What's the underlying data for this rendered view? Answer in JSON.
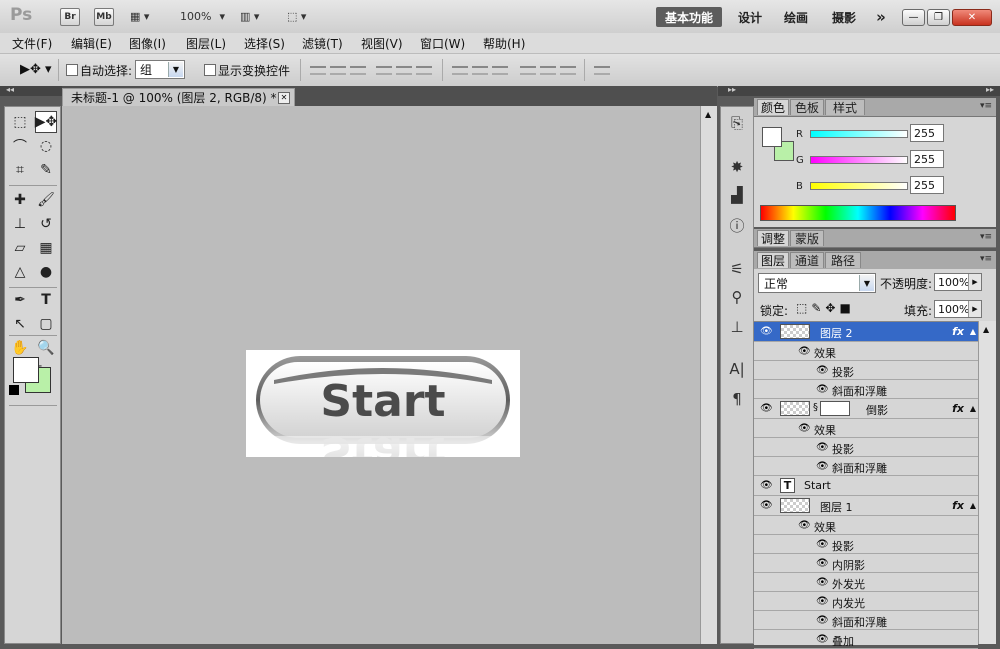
{
  "appbar": {
    "logo": "Ps",
    "bridge": "Br",
    "minibridge": "Mb",
    "zoom": "100%",
    "workspaces": [
      "基本功能",
      "设计",
      "绘画",
      "摄影"
    ],
    "more": "»"
  },
  "menu": [
    "文件(F)",
    "编辑(E)",
    "图像(I)",
    "图层(L)",
    "选择(S)",
    "滤镜(T)",
    "视图(V)",
    "窗口(W)",
    "帮助(H)"
  ],
  "options": {
    "auto_select_label": "自动选择:",
    "auto_select_value": "组",
    "show_transform_label": "显示变换控件"
  },
  "document": {
    "tab_title": "未标题-1 @ 100% (图层 2, RGB/8) *",
    "button_text": "Start"
  },
  "color_panel": {
    "tabs": [
      "颜色",
      "色板",
      "样式"
    ],
    "channels": [
      {
        "label": "R",
        "value": "255"
      },
      {
        "label": "G",
        "value": "255"
      },
      {
        "label": "B",
        "value": "255"
      }
    ],
    "fg_color": "#ffffff",
    "bg_color": "#b9f0a8"
  },
  "adjust_panel": {
    "tabs": [
      "调整",
      "蒙版"
    ]
  },
  "layers_panel": {
    "tabs": [
      "图层",
      "通道",
      "路径"
    ],
    "blend_mode": "正常",
    "opacity_label": "不透明度:",
    "opacity_value": "100%",
    "lock_label": "锁定:",
    "fill_label": "填充:",
    "fill_value": "100%",
    "layers": [
      {
        "name": "图层 2",
        "type": "layer",
        "fx": "fx",
        "selected": true
      },
      {
        "name": "效果",
        "type": "effects"
      },
      {
        "name": "投影",
        "type": "effect"
      },
      {
        "name": "斜面和浮雕",
        "type": "effect"
      },
      {
        "name": "倒影",
        "type": "masked-layer",
        "fx": "fx"
      },
      {
        "name": "效果",
        "type": "effects"
      },
      {
        "name": "投影",
        "type": "effect"
      },
      {
        "name": "斜面和浮雕",
        "type": "effect"
      },
      {
        "name": "Start",
        "type": "text",
        "thumb": "T"
      },
      {
        "name": "图层 1",
        "type": "layer",
        "fx": "fx"
      },
      {
        "name": "效果",
        "type": "effects"
      },
      {
        "name": "投影",
        "type": "effect"
      },
      {
        "name": "内阴影",
        "type": "effect"
      },
      {
        "name": "外发光",
        "type": "effect"
      },
      {
        "name": "内发光",
        "type": "effect"
      },
      {
        "name": "斜面和浮雕",
        "type": "effect"
      },
      {
        "name": "叠加",
        "type": "effect"
      }
    ]
  }
}
